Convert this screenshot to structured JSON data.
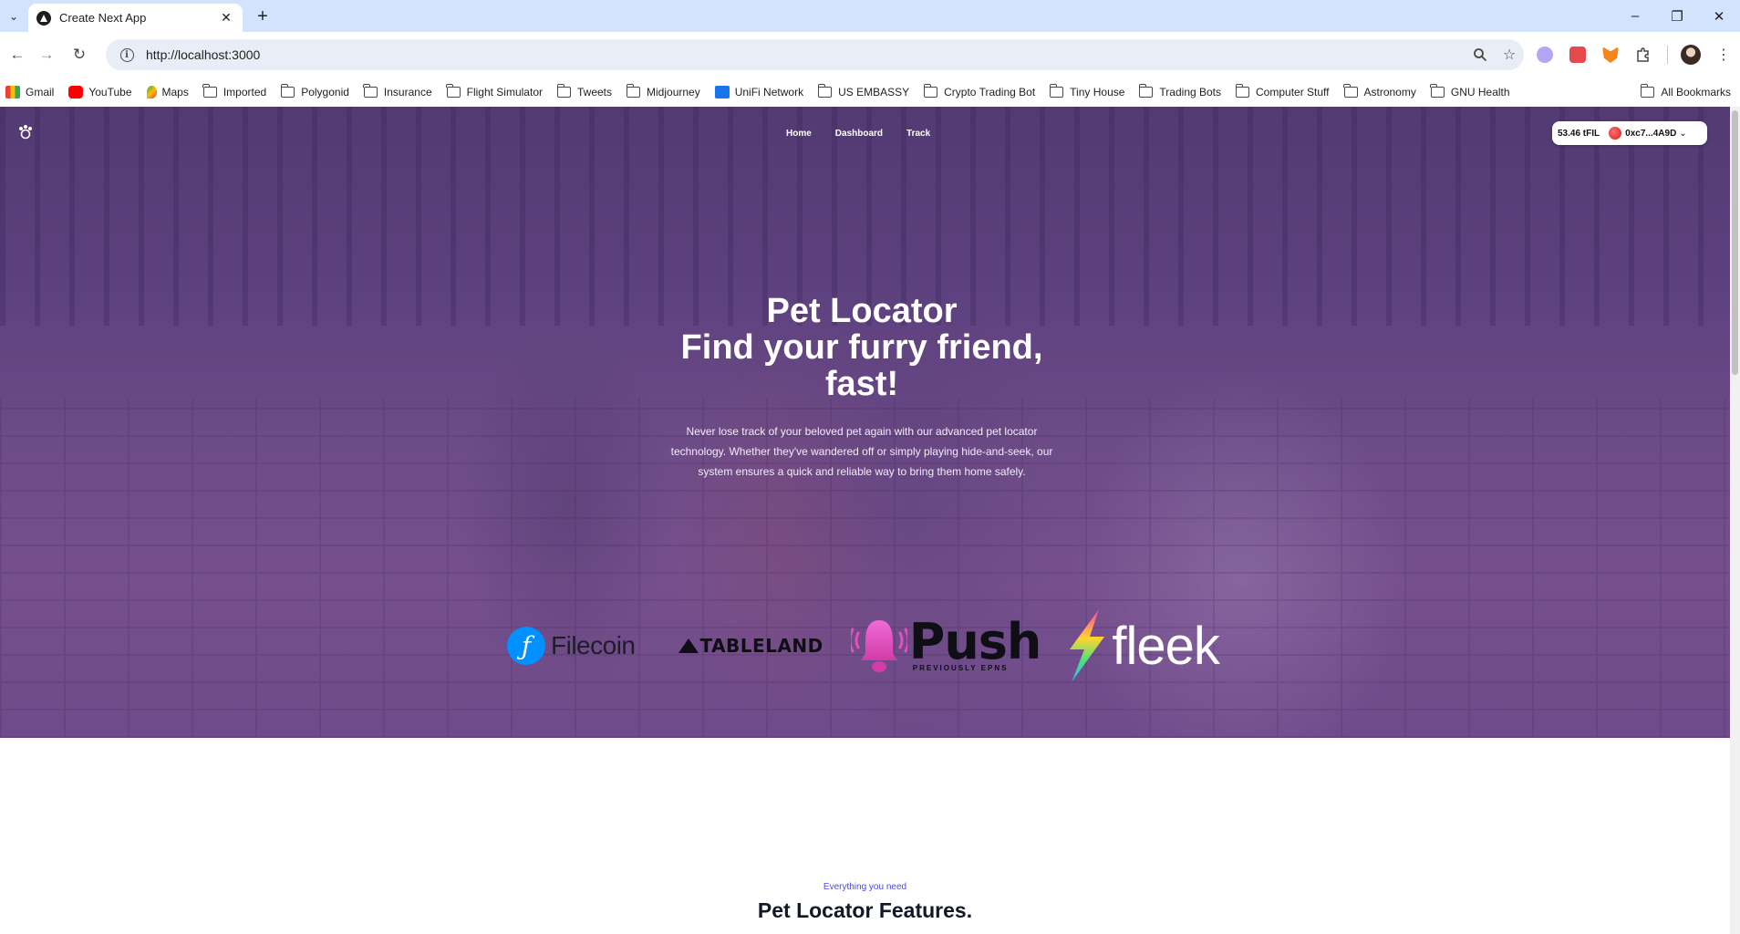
{
  "browser": {
    "tab_title": "Create Next App",
    "url": "http://localhost:3000",
    "window_controls": [
      "–",
      "❐",
      "✕"
    ],
    "bookmarks": [
      {
        "label": "Gmail",
        "icon": "gmail-icon"
      },
      {
        "label": "YouTube",
        "icon": "youtube-icon"
      },
      {
        "label": "Maps",
        "icon": "maps-icon"
      },
      {
        "label": "Imported",
        "icon": "folder-icon"
      },
      {
        "label": "Polygonid",
        "icon": "folder-icon"
      },
      {
        "label": "Insurance",
        "icon": "folder-icon"
      },
      {
        "label": "Flight Simulator",
        "icon": "folder-icon"
      },
      {
        "label": "Tweets",
        "icon": "folder-icon"
      },
      {
        "label": "Midjourney",
        "icon": "folder-icon"
      },
      {
        "label": "UniFi Network",
        "icon": "unifi-icon"
      },
      {
        "label": "US EMBASSY",
        "icon": "folder-icon"
      },
      {
        "label": "Crypto Trading Bot",
        "icon": "folder-icon"
      },
      {
        "label": "Tiny House",
        "icon": "folder-icon"
      },
      {
        "label": "Trading Bots",
        "icon": "folder-icon"
      },
      {
        "label": "Computer Stuff",
        "icon": "folder-icon"
      },
      {
        "label": "Astronomy",
        "icon": "folder-icon"
      },
      {
        "label": "GNU Health",
        "icon": "folder-icon"
      }
    ],
    "all_bookmarks": "All Bookmarks"
  },
  "nav": {
    "links": [
      "Home",
      "Dashboard",
      "Track"
    ]
  },
  "wallet": {
    "balance": "53.46 tFIL",
    "address": "0xc7...4A9D"
  },
  "hero": {
    "title_lines": [
      "Pet Locator",
      "Find your furry friend,",
      "fast!"
    ],
    "description": "Never lose track of your beloved pet again with our advanced pet locator technology. Whether they've wandered off or simply playing hide-and-seek, our system ensures a quick and reliable way to bring them home safely."
  },
  "partners": {
    "filecoin": "Filecoin",
    "tableland": "TABLELAND",
    "push": "Push",
    "push_sub": "PREVIOUSLY EPNS",
    "fleek": "fleek"
  },
  "features": {
    "eyebrow": "Everything you need",
    "title": "Pet Locator Features."
  },
  "colors": {
    "tabbar": "#d3e3fd",
    "overlay": "#703caa",
    "accent": "#4f46e5",
    "filecoin": "#0090ff"
  }
}
